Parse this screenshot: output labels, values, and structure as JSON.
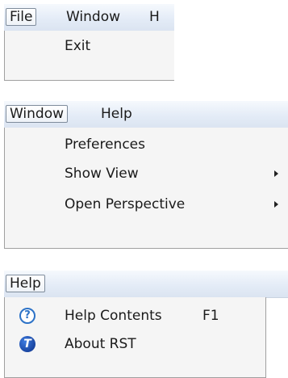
{
  "file_panel": {
    "menubar": [
      "File",
      "Window",
      "H"
    ],
    "items": [
      {
        "label": "Exit"
      }
    ]
  },
  "window_panel": {
    "menubar": [
      "Window",
      "Help"
    ],
    "items": [
      {
        "label": "Preferences"
      },
      {
        "label": "Show View",
        "submenu": true
      },
      {
        "label": "Open Perspective",
        "submenu": true
      }
    ]
  },
  "help_panel": {
    "menubar": [
      "Help"
    ],
    "items": [
      {
        "label": "Help Contents",
        "shortcut": "F1",
        "icon": "help-circle-icon",
        "glyph": "?"
      },
      {
        "label": "About RST",
        "icon": "rst-logo-icon",
        "glyph": "T"
      }
    ]
  }
}
